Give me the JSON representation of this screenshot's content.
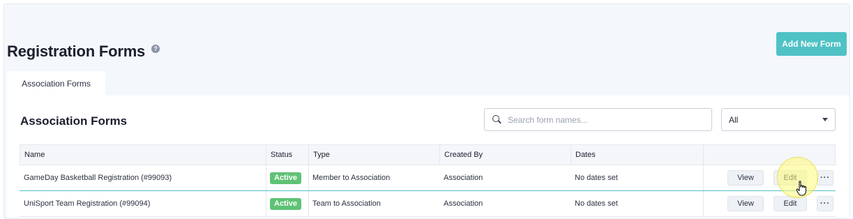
{
  "header": {
    "title": "Registration Forms",
    "help_glyph": "?",
    "add_button": "Add New Form"
  },
  "tabs": [
    {
      "label": "Association Forms",
      "active": true
    }
  ],
  "panel": {
    "title": "Association Forms",
    "search": {
      "placeholder": "Search form names...",
      "value": ""
    },
    "filter": {
      "selected": "All"
    }
  },
  "table": {
    "columns": [
      "Name",
      "Status",
      "Type",
      "Created By",
      "Dates"
    ],
    "rows": [
      {
        "name": "GameDay Basketball Registration (#99093)",
        "status": "Active",
        "type": "Member to Association",
        "created_by": "Association",
        "dates": "No dates set"
      },
      {
        "name": "UniSport Team Registration (#99094)",
        "status": "Active",
        "type": "Team to Association",
        "created_by": "Association",
        "dates": "No dates set"
      }
    ],
    "actions": {
      "view": "View",
      "edit": "Edit",
      "more": "···"
    }
  },
  "colors": {
    "accent": "#4fc2c5",
    "status_active": "#5fc276",
    "page_bg": "#f4f7fb"
  }
}
